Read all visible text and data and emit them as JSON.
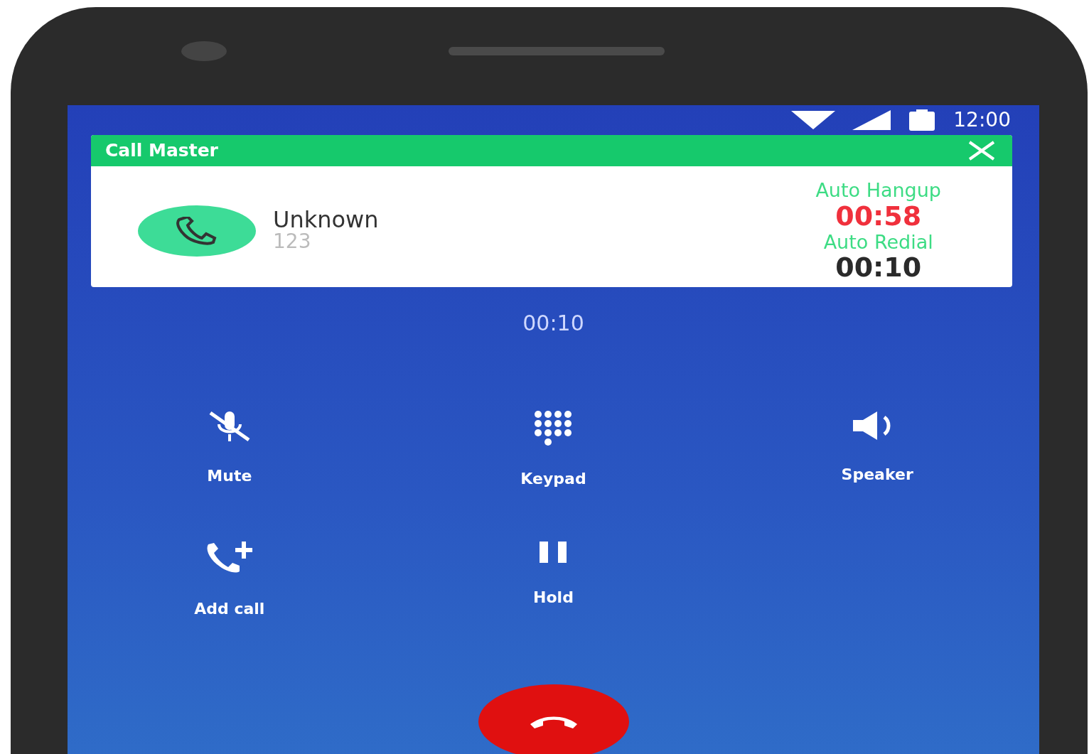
{
  "status_bar": {
    "time": "12:00"
  },
  "overlay": {
    "title": "Call Master",
    "caller_name": "Unknown",
    "caller_number": "123",
    "timers": [
      {
        "label": "Auto Hangup",
        "time": "00:58",
        "kind": "hangup"
      },
      {
        "label": "Auto Redial",
        "time": "00:10",
        "kind": "redial"
      }
    ]
  },
  "call": {
    "duration": "00:10"
  },
  "actions": [
    {
      "kind": "mute",
      "label": "Mute"
    },
    {
      "kind": "keypad",
      "label": "Keypad"
    },
    {
      "kind": "speaker",
      "label": "Speaker"
    },
    {
      "kind": "addcall",
      "label": "Add call"
    },
    {
      "kind": "hold",
      "label": "Hold"
    }
  ]
}
